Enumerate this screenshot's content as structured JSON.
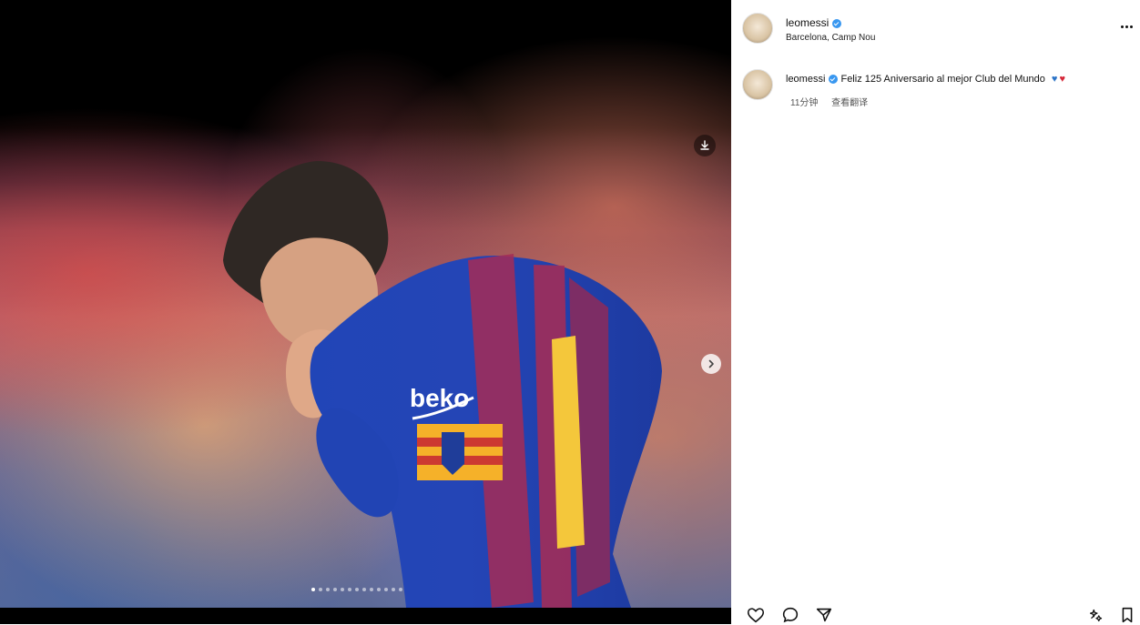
{
  "post": {
    "image_alt": "",
    "slide_count": 13,
    "active_slide": 1
  },
  "profile": {
    "username": "leomessi",
    "location": "Barcelona, Camp Nou"
  },
  "caption": {
    "username": "leomessi",
    "text": "Feliz 125 Aniversario al mejor Club del Mundo",
    "time": "11分钟",
    "translate": "查看翻译"
  },
  "icons": {
    "save_on_media": "save-icon",
    "next": "chevron-right-icon",
    "like": "heart-icon",
    "comment": "comment-icon",
    "share": "send-icon",
    "bookmark": "bookmark-icon",
    "sparkle": "sparkle-icon"
  }
}
